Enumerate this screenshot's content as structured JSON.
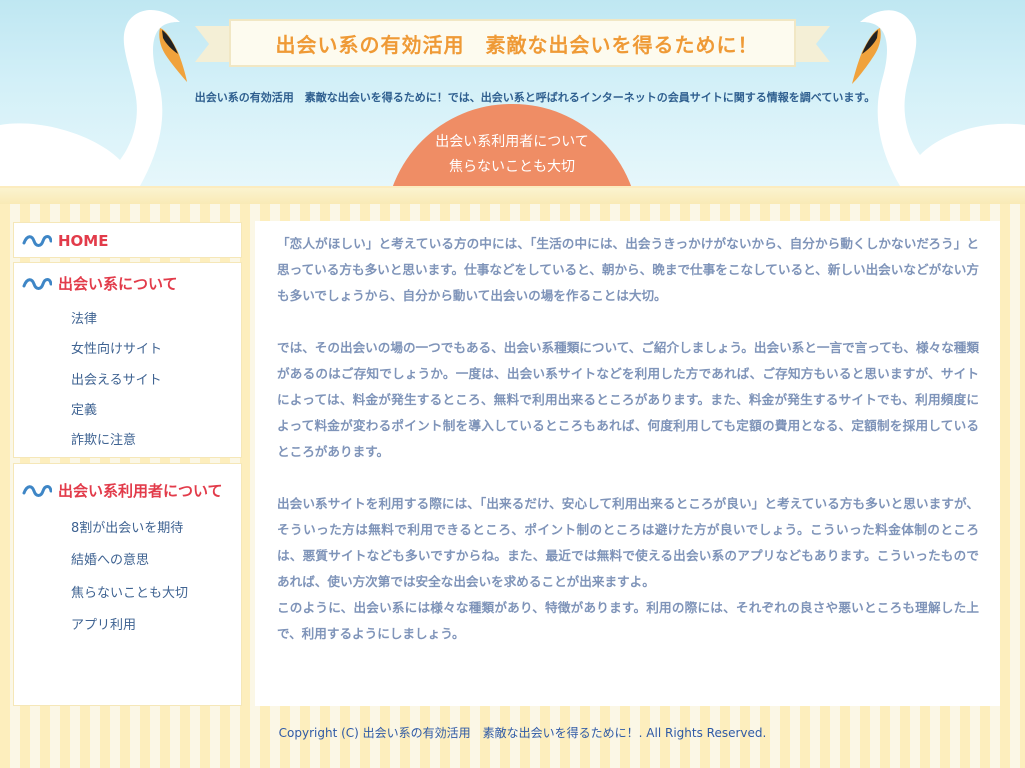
{
  "header": {
    "title": "出会い系の有効活用　素敵な出会いを得るために！",
    "tagline": "出会い系の有効活用　素敵な出会いを得るために！では、出会い系と呼ばれるインターネットの会員サイトに関する情報を調べています。",
    "badge_line1": "出会い系利用者について",
    "badge_line2": "焦らないことも大切"
  },
  "sidebar": {
    "home": "HOME",
    "about": {
      "heading": "出会い系について",
      "links": [
        "法律",
        "女性向けサイト",
        "出会えるサイト",
        "定義",
        "詐欺に注意"
      ]
    },
    "users": {
      "heading": "出会い系利用者について",
      "links": [
        "8割が出会いを期待",
        "結婚への意思",
        "焦らないことも大切",
        "アプリ利用"
      ]
    }
  },
  "content": {
    "paragraphs": [
      "「恋人がほしい」と考えている方の中には、「生活の中には、出会うきっかけがないから、自分から動くしかないだろう」と思っている方も多いと思います。仕事などをしていると、朝から、晩まで仕事をこなしていると、新しい出会いなどがない方も多いでしょうから、自分から動いて出会いの場を作ることは大切。",
      "では、その出会いの場の一つでもある、出会い系種類について、ご紹介しましょう。出会い系と一言で言っても、様々な種類があるのはご存知でしょうか。一度は、出会い系サイトなどを利用した方であれば、ご存知方もいると思いますが、サイトによっては、料金が発生するところ、無料で利用出来るところがあります。また、料金が発生するサイトでも、利用頻度によって料金が変わるポイント制を導入しているところもあれば、何度利用しても定額の費用となる、定額制を採用しているところがあります。",
      "出会い系サイトを利用する際には、「出来るだけ、安心して利用出来るところが良い」と考えている方も多いと思いますが、そういった方は無料で利用できるところ、ポイント制のところは避けた方が良いでしょう。こういった料金体制のところは、悪質サイトなども多いですからね。また、最近では無料で使える出会い系のアプリなどもあります。こういったものであれば、使い方次第では安全な出会いを求めることが出来ますよ。",
      "このように、出会い系には様々な種類があり、特徴があります。利用の際には、それぞれの良さや悪いところも理解した上で、利用するようにしましょう。"
    ]
  },
  "footer": {
    "copyright": "Copyright (C)  出会い系の有効活用　素敵な出会いを得るために！.  All Rights Reserved."
  },
  "icons": {
    "nav": "wave-icon",
    "swan": "swan-illustration"
  },
  "colors": {
    "accent_red": "#e23b4a",
    "link_blue": "#3f6392",
    "badge": "#ef8d65",
    "title_orange": "#ef9a36"
  }
}
